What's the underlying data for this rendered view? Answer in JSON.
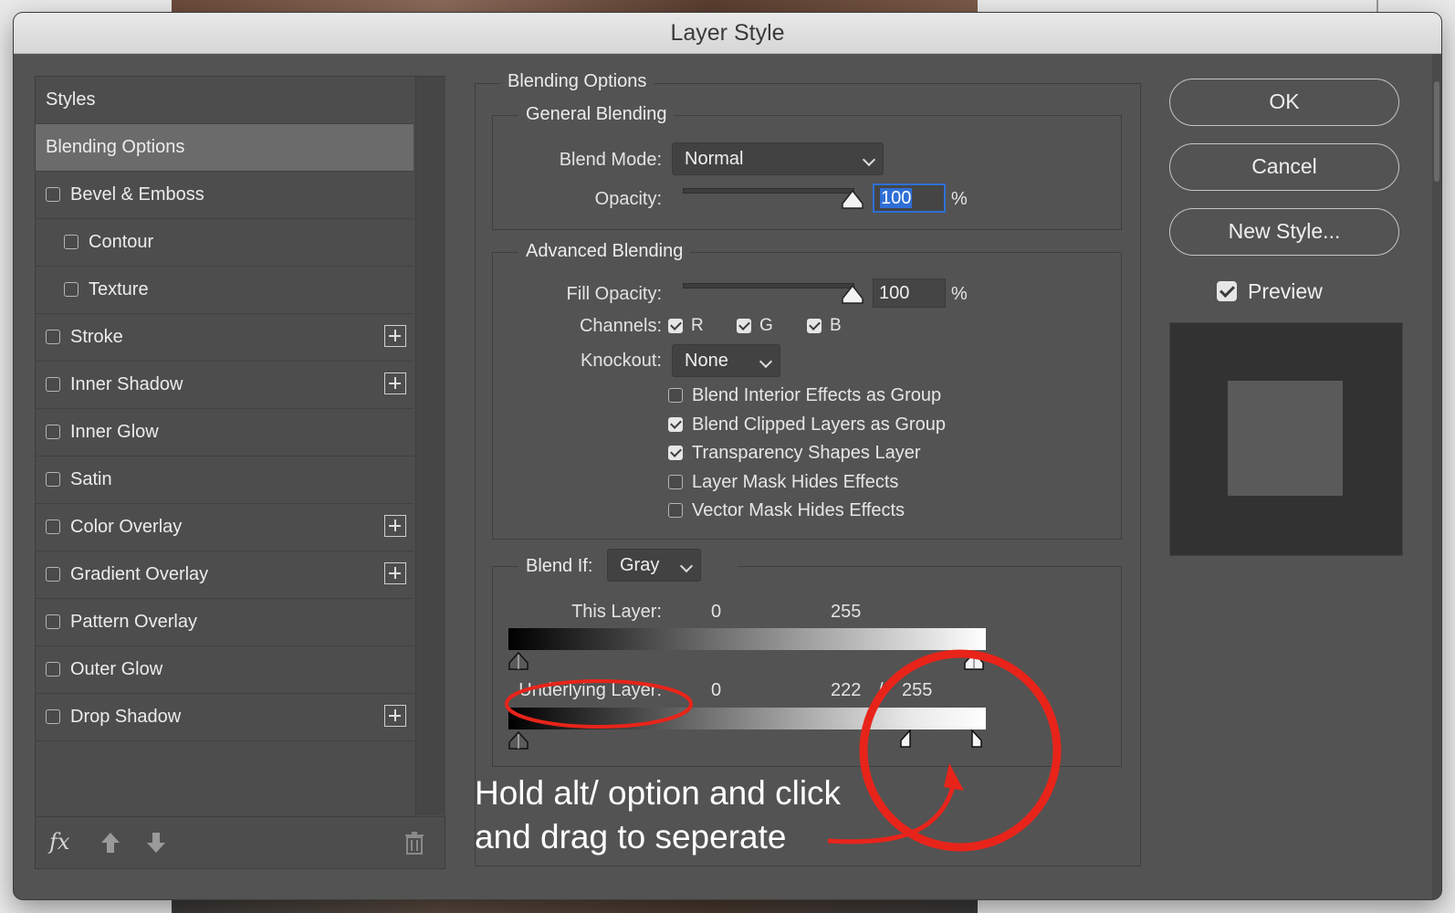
{
  "window": {
    "title": "Layer Style"
  },
  "styles_list": {
    "items": [
      {
        "label": "Styles",
        "header": true
      },
      {
        "label": "Blending Options",
        "selected": true
      },
      {
        "label": "Bevel & Emboss",
        "checkbox": true,
        "checked": false
      },
      {
        "label": "Contour",
        "checkbox": true,
        "checked": false,
        "indent": true
      },
      {
        "label": "Texture",
        "checkbox": true,
        "checked": false,
        "indent": true
      },
      {
        "label": "Stroke",
        "checkbox": true,
        "checked": false,
        "plus": true
      },
      {
        "label": "Inner Shadow",
        "checkbox": true,
        "checked": false,
        "plus": true
      },
      {
        "label": "Inner Glow",
        "checkbox": true,
        "checked": false
      },
      {
        "label": "Satin",
        "checkbox": true,
        "checked": false
      },
      {
        "label": "Color Overlay",
        "checkbox": true,
        "checked": false,
        "plus": true
      },
      {
        "label": "Gradient Overlay",
        "checkbox": true,
        "checked": false,
        "plus": true
      },
      {
        "label": "Pattern Overlay",
        "checkbox": true,
        "checked": false
      },
      {
        "label": "Outer Glow",
        "checkbox": true,
        "checked": false
      },
      {
        "label": "Drop Shadow",
        "checkbox": true,
        "checked": false,
        "plus": true
      }
    ],
    "footer": {
      "fx_label": "fx"
    }
  },
  "blending_options": {
    "title": "Blending Options",
    "general": {
      "title": "General Blending",
      "blend_mode_label": "Blend Mode:",
      "blend_mode_value": "Normal",
      "opacity_label": "Opacity:",
      "opacity_value": "100",
      "opacity_unit": "%"
    },
    "advanced": {
      "title": "Advanced Blending",
      "fill_opacity_label": "Fill Opacity:",
      "fill_opacity_value": "100",
      "fill_opacity_unit": "%",
      "channels_label": "Channels:",
      "channels": [
        {
          "label": "R",
          "checked": true
        },
        {
          "label": "G",
          "checked": true
        },
        {
          "label": "B",
          "checked": true
        }
      ],
      "knockout_label": "Knockout:",
      "knockout_value": "None",
      "options": [
        {
          "label": "Blend Interior Effects as Group",
          "checked": false
        },
        {
          "label": "Blend Clipped Layers as Group",
          "checked": true
        },
        {
          "label": "Transparency Shapes Layer",
          "checked": true
        },
        {
          "label": "Layer Mask Hides Effects",
          "checked": false
        },
        {
          "label": "Vector Mask Hides Effects",
          "checked": false
        }
      ]
    },
    "blend_if": {
      "label": "Blend If:",
      "value": "Gray",
      "this_layer": {
        "label": "This Layer:",
        "low": "0",
        "high": "255"
      },
      "underlying_layer": {
        "label": "Underlying Layer:",
        "low": "0",
        "high_a": "222",
        "separator": "/",
        "high_b": "255"
      }
    }
  },
  "buttons": {
    "ok": "OK",
    "cancel": "Cancel",
    "new_style": "New Style...",
    "preview_label": "Preview",
    "preview_checked": true
  },
  "annotation": {
    "line1": "Hold alt/ option and click",
    "line2": "and drag to seperate",
    "color": "#e8241a"
  },
  "colors": {
    "dialog_bg": "#535353",
    "selected_item": "#6b6b6b",
    "focus_blue": "#2f6fd6"
  }
}
